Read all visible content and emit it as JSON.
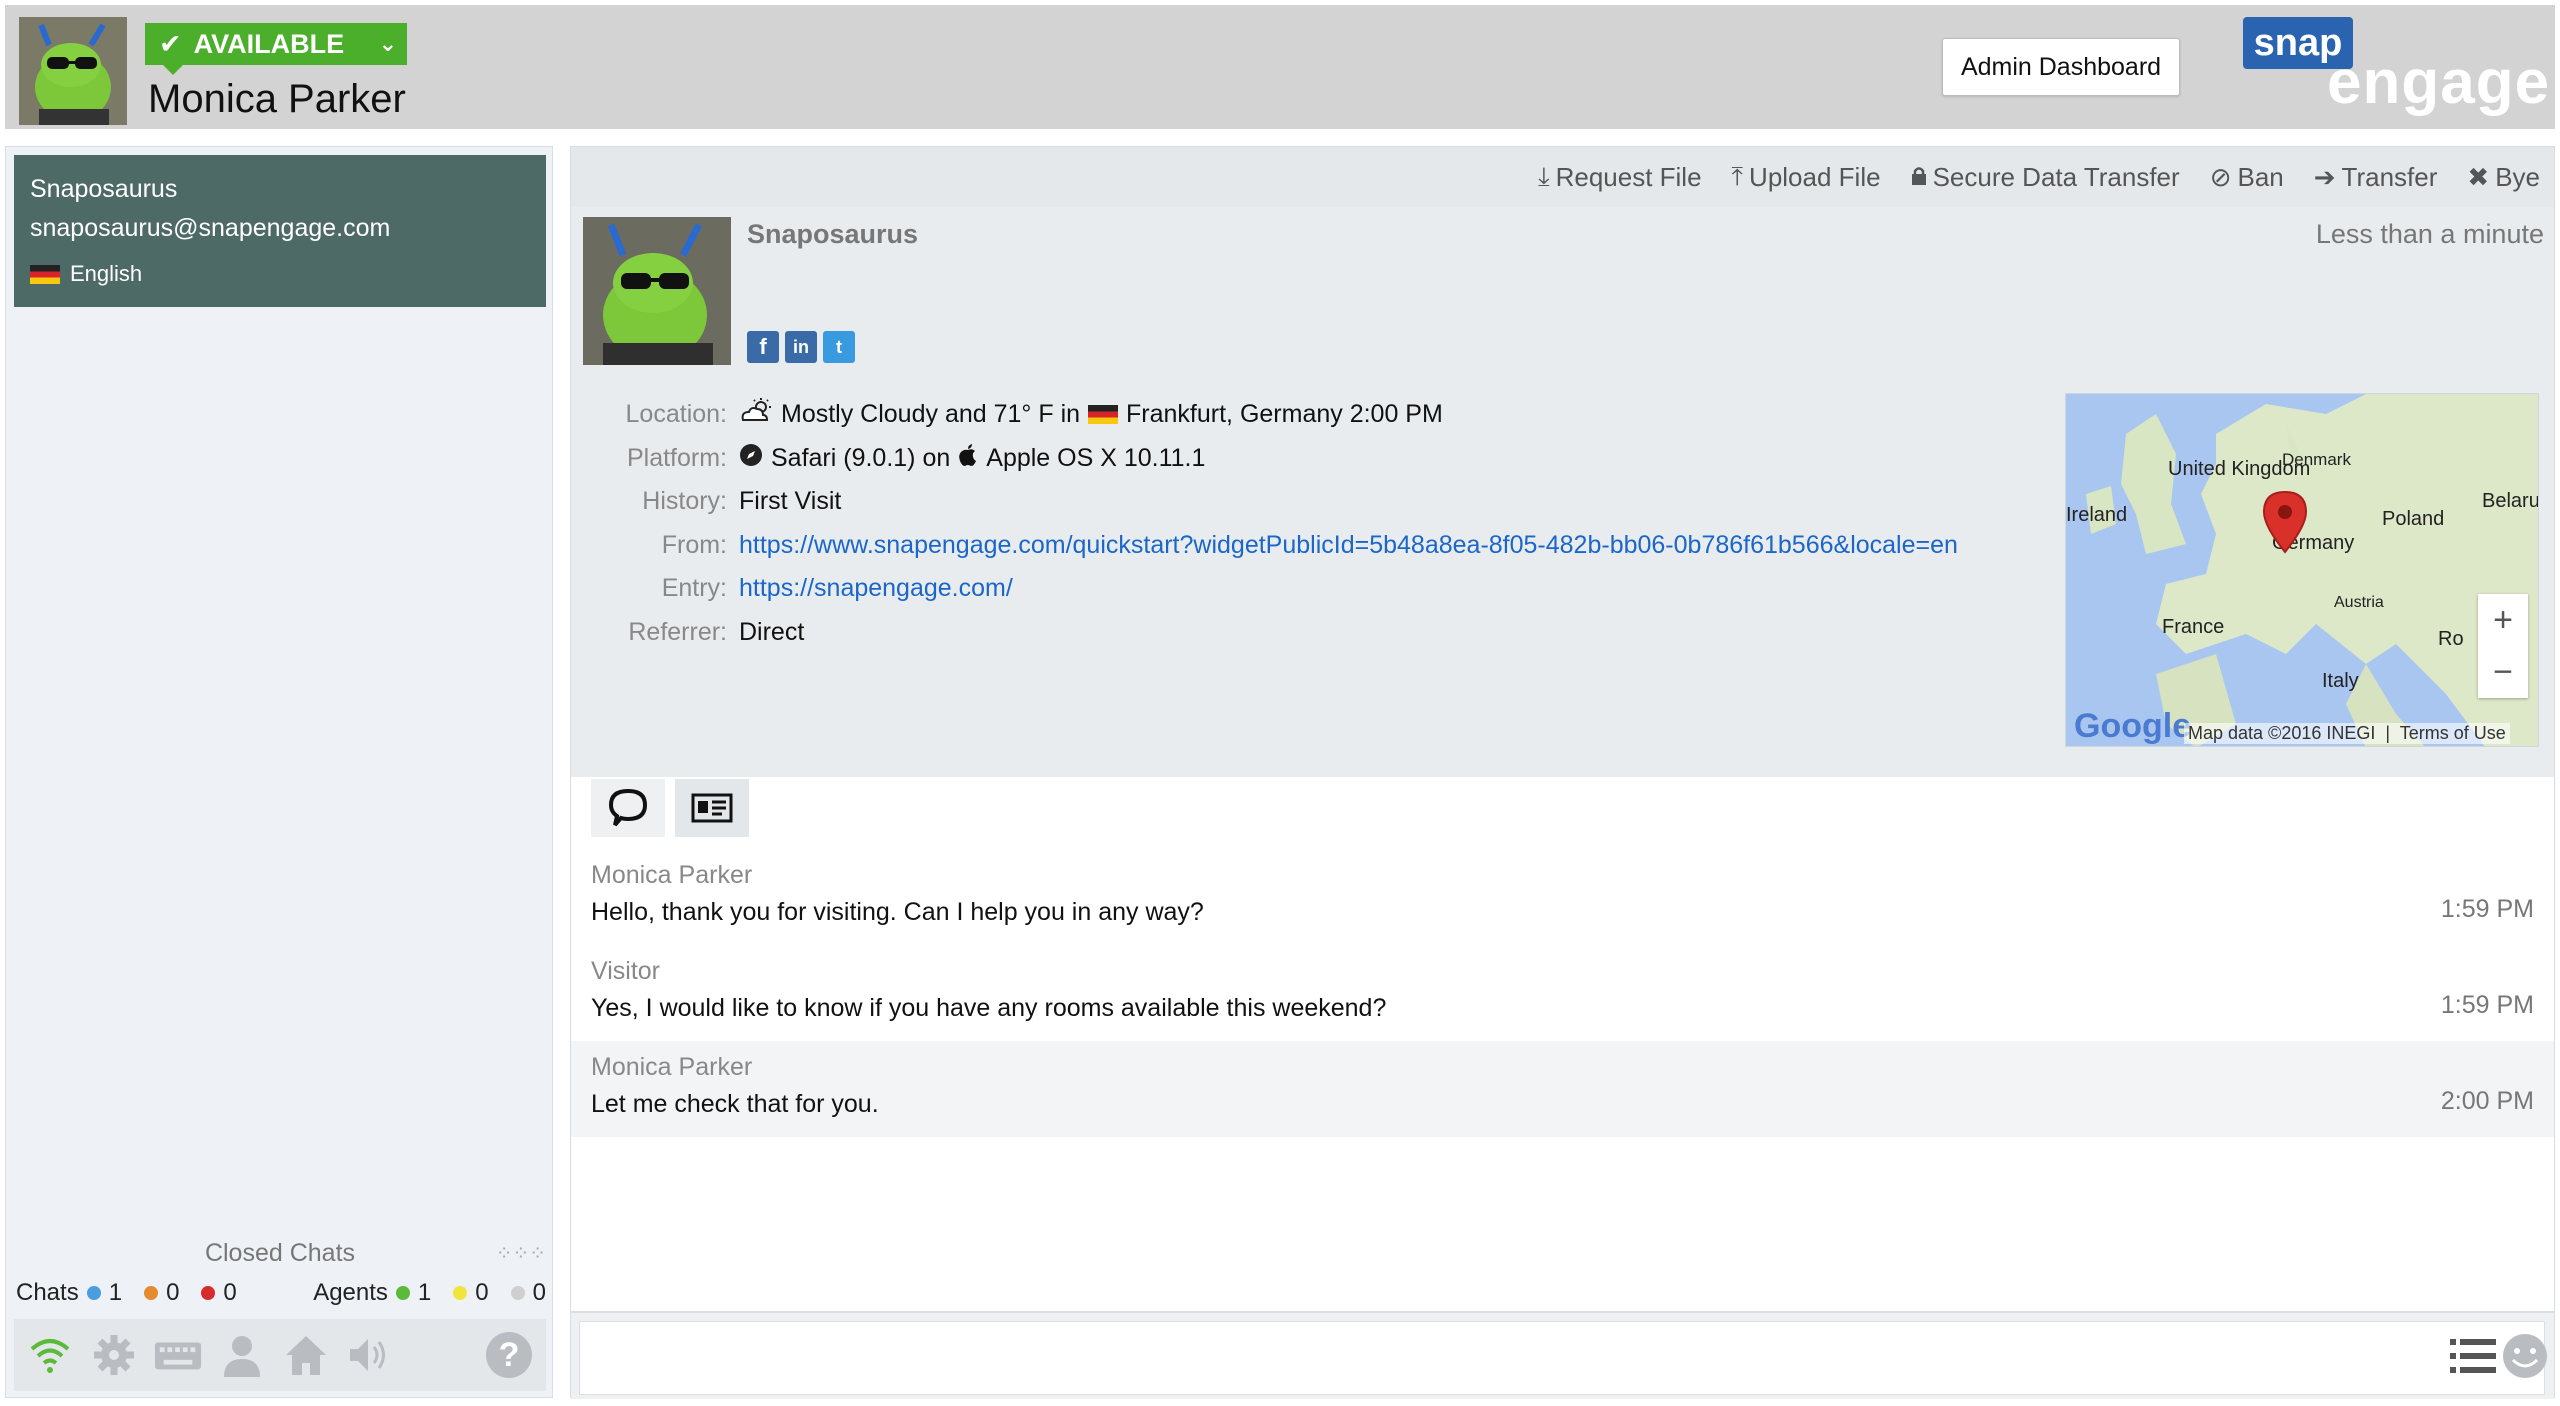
{
  "header": {
    "status": "AVAILABLE",
    "agent_name": "Monica Parker",
    "admin_button": "Admin Dashboard",
    "logo_top": "snap",
    "logo_bottom": "engage"
  },
  "sidebar": {
    "visitor": {
      "name": "Snaposaurus",
      "email": "snaposaurus@snapengage.com",
      "language": "English"
    },
    "closed_chats": "Closed Chats",
    "counts": {
      "chats_label": "Chats",
      "chats": [
        "1",
        "0",
        "0"
      ],
      "agents_label": "Agents",
      "agents": [
        "1",
        "0",
        "0"
      ]
    }
  },
  "toolbar": {
    "request_file": "Request File",
    "upload_file": "Upload File",
    "secure_transfer": "Secure Data Transfer",
    "ban": "Ban",
    "transfer": "Transfer",
    "bye": "Bye"
  },
  "visitor_info": {
    "name": "Snaposaurus",
    "duration": "Less than a minute",
    "details": {
      "location_label": "Location:",
      "location_weather": "Mostly Cloudy and 71° F in",
      "location_city": "Frankfurt, Germany 2:00 PM",
      "platform_label": "Platform:",
      "platform_browser": "Safari (9.0.1) on",
      "platform_os": "Apple OS X 10.11.1",
      "history_label": "History:",
      "history": "First Visit",
      "from_label": "From:",
      "from": "https://www.snapengage.com/quickstart?widgetPublicId=5b48a8ea-8f05-482b-bb06-0b786f61b566&locale=en",
      "entry_label": "Entry:",
      "entry": "https://snapengage.com/",
      "referrer_label": "Referrer:",
      "referrer": "Direct"
    },
    "map": {
      "labels": [
        "United Kingdom",
        "Ireland",
        "Denmark",
        "Belarus",
        "Poland",
        "Germany",
        "France",
        "Austria",
        "Italy",
        "Ro"
      ],
      "credit": "Map data ©2016 INEGI",
      "terms": "Terms of Use",
      "google": "Google"
    }
  },
  "messages": [
    {
      "who": "Monica Parker",
      "text": "Hello, thank you for visiting. Can I help you in any way?",
      "time": "1:59 PM"
    },
    {
      "who": "Visitor",
      "text": "Yes, I would like to know if you have any rooms available this weekend?",
      "time": "1:59 PM"
    },
    {
      "who": "Monica Parker",
      "text": "Let me check that for you.",
      "time": "2:00 PM"
    }
  ],
  "colors": {
    "available": "#4caf2c",
    "visitor_card": "#4d6a67",
    "link": "#1a66c9",
    "brand": "#2a63b0"
  }
}
